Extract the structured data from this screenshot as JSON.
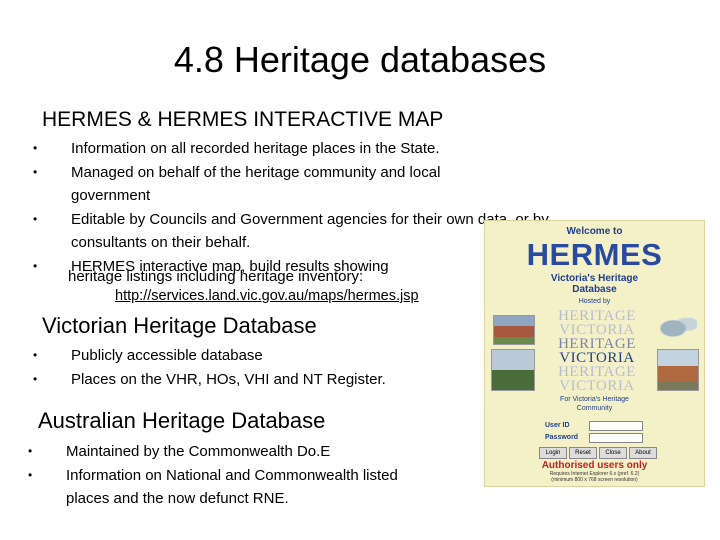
{
  "title": "4.8 Heritage databases",
  "sections": [
    {
      "heading": "HERMES & HERMES INTERACTIVE MAP",
      "bullets": [
        "Information on all recorded heritage places in the State.",
        "Managed on behalf of the heritage community and local government",
        "Editable by Councils and Government agencies for their own data, or by",
        "consultants on their behalf.",
        "HERMES interactive map, build results showing",
        "heritage listings including heritage inventory:",
        "http://services.land.vic.gov.au/maps/hermes.jsp"
      ]
    },
    {
      "heading": "Victorian Heritage Database",
      "bullets": [
        "Publicly accessible database",
        "Places on the VHR, HOs, VHI and NT Register."
      ]
    },
    {
      "heading": "Australian Heritage Database",
      "bullets": [
        "Maintained by the Commonwealth Do.E",
        "Information on National and Commonwealth listed",
        "places and the now defunct RNE."
      ]
    }
  ],
  "bullet_glyph": "•",
  "hermes_panel": {
    "welcome": "Welcome to",
    "logo": "HERMES",
    "subtitle_1": "Victoria's Heritage",
    "subtitle_2": "Database",
    "hosted_by": "Hosted by",
    "hv_words": [
      "HERITAGE",
      "VICTORIA",
      "HERITAGE",
      "VICTORIA",
      "HERITAGE",
      "VICTORIA"
    ],
    "hv_colors": [
      "#b7bdcf",
      "#b7bdcf",
      "#7a86a8",
      "#1f3e8c",
      "#b7bdcf",
      "#b7bdcf"
    ],
    "community_1": "For Victoria's Heritage",
    "community_2": "Community",
    "user_id_label": "User ID",
    "password_label": "Password",
    "buttons": [
      "Login",
      "Reset",
      "Close",
      "About"
    ],
    "authorised": "Authorised users only",
    "requires_1": "Requires Internet Explorer 6.x (pref. 6.2)",
    "requires_2": "(minimum 800 x 768 screen resolution)",
    "colors": {
      "background": "#f4f1c9",
      "blue": "#2a4aa0",
      "red": "#c02020"
    }
  }
}
